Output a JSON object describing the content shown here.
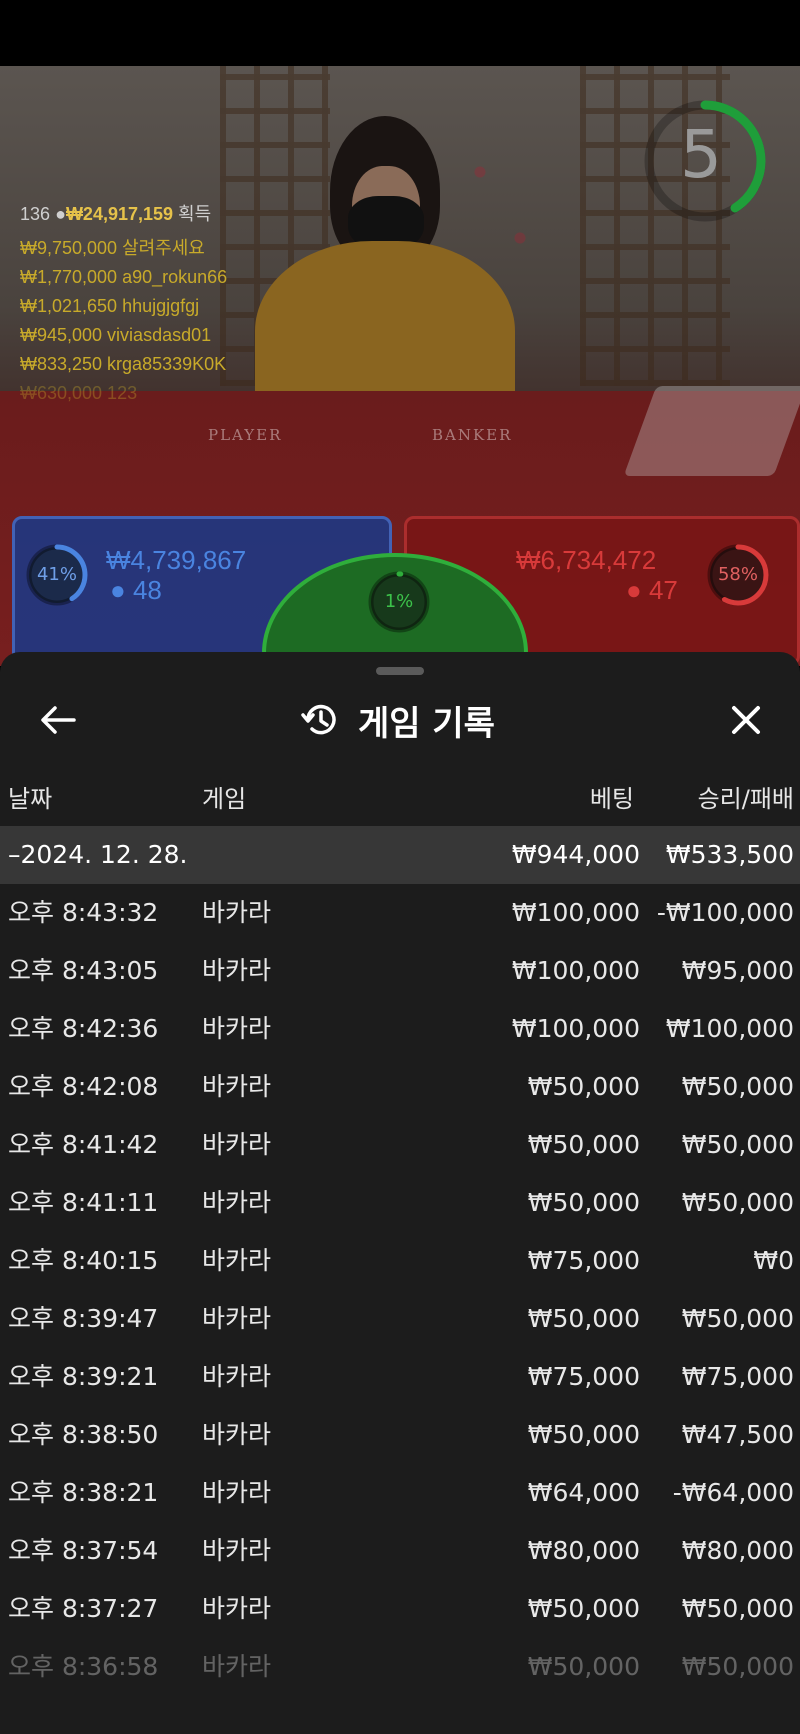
{
  "stream": {
    "timer": "5",
    "table_labels": {
      "player": "PLAYER",
      "banker": "BANKER"
    },
    "winners_header": {
      "count": "136",
      "amount": "₩24,917,159",
      "suffix": "획득"
    },
    "winners": [
      {
        "text": "₩9,750,000  살려주세요"
      },
      {
        "text": "₩1,770,000  a90_rokun66"
      },
      {
        "text": "₩1,021,650  hhujgjgfgj"
      },
      {
        "text": "₩945,000  viviasdasd01"
      },
      {
        "text": "₩833,250  krga85339K0K"
      },
      {
        "text": "₩630,000  123"
      }
    ],
    "player": {
      "percent": "41%",
      "percent_value": 0.41,
      "amount": "₩4,739,867",
      "count": "48",
      "color": "#4a84e0"
    },
    "banker": {
      "percent": "58%",
      "percent_value": 0.58,
      "amount": "₩6,734,472",
      "count": "47",
      "color": "#d83a3a"
    },
    "tie": {
      "percent": "1%",
      "percent_value": 0.01,
      "color": "#2fae3b"
    }
  },
  "sheet": {
    "title": "게임 기록",
    "columns": {
      "date": "날짜",
      "game": "게임",
      "bet": "베팅",
      "result": "승리/패배"
    },
    "summary": {
      "date": "–2024. 12. 28.",
      "bet": "₩944,000",
      "result": "₩533,500"
    },
    "rows": [
      {
        "time": "오후 8:43:32",
        "game": "바카라",
        "bet": "₩100,000",
        "result": "-₩100,000"
      },
      {
        "time": "오후 8:43:05",
        "game": "바카라",
        "bet": "₩100,000",
        "result": "₩95,000"
      },
      {
        "time": "오후 8:42:36",
        "game": "바카라",
        "bet": "₩100,000",
        "result": "₩100,000"
      },
      {
        "time": "오후 8:42:08",
        "game": "바카라",
        "bet": "₩50,000",
        "result": "₩50,000"
      },
      {
        "time": "오후 8:41:42",
        "game": "바카라",
        "bet": "₩50,000",
        "result": "₩50,000"
      },
      {
        "time": "오후 8:41:11",
        "game": "바카라",
        "bet": "₩50,000",
        "result": "₩50,000"
      },
      {
        "time": "오후 8:40:15",
        "game": "바카라",
        "bet": "₩75,000",
        "result": "₩0"
      },
      {
        "time": "오후 8:39:47",
        "game": "바카라",
        "bet": "₩50,000",
        "result": "₩50,000"
      },
      {
        "time": "오후 8:39:21",
        "game": "바카라",
        "bet": "₩75,000",
        "result": "₩75,000"
      },
      {
        "time": "오후 8:38:50",
        "game": "바카라",
        "bet": "₩50,000",
        "result": "₩47,500"
      },
      {
        "time": "오후 8:38:21",
        "game": "바카라",
        "bet": "₩64,000",
        "result": "-₩64,000"
      },
      {
        "time": "오후 8:37:54",
        "game": "바카라",
        "bet": "₩80,000",
        "result": "₩80,000"
      },
      {
        "time": "오후 8:37:27",
        "game": "바카라",
        "bet": "₩50,000",
        "result": "₩50,000"
      },
      {
        "time": "오후 8:36:58",
        "game": "바카라",
        "bet": "₩50,000",
        "result": "₩50,000"
      }
    ]
  }
}
